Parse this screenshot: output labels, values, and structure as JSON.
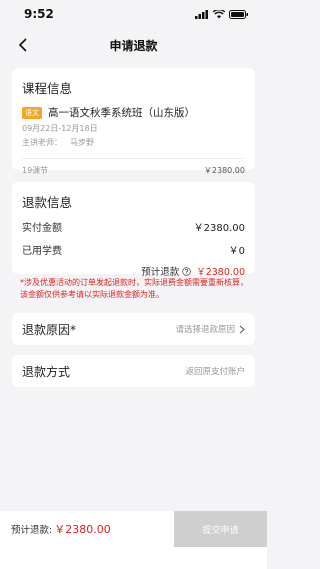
{
  "status_bar": {
    "time": "9:52"
  },
  "nav": {
    "title": "申请退款"
  },
  "course": {
    "section_title": "课程信息",
    "tag": "语文",
    "name": "高一语文秋季系统班（山东版）",
    "dates": "09月22日-12月18日",
    "teacher_label": "主讲老师：",
    "teacher": "马步野",
    "lessons": "19课节",
    "price": "￥2380.00"
  },
  "refund_info": {
    "section_title": "退款信息",
    "paid_label": "实付金额",
    "paid_value": "￥2380.00",
    "used_label": "已用学费",
    "used_value": "￥0",
    "estimate_label": "预计退款",
    "estimate_value": "￥2380.00"
  },
  "note": "*涉及优惠活动的订单发起退款时，实际退费金额需要重新核算，该金额仅供参考请以实际退款金额为准。",
  "reason": {
    "label": "退款原因*",
    "placeholder": "请选择退款原因"
  },
  "method": {
    "label": "退款方式",
    "value": "返回原支付账户"
  },
  "footer": {
    "estimate_label": "预计退款:",
    "estimate_value": "￥2380.00",
    "submit_label": "提交申请"
  },
  "colors": {
    "accent_red": "#e02020",
    "tag_orange": "#f5a623",
    "submit_disabled": "#cfcfcf"
  }
}
